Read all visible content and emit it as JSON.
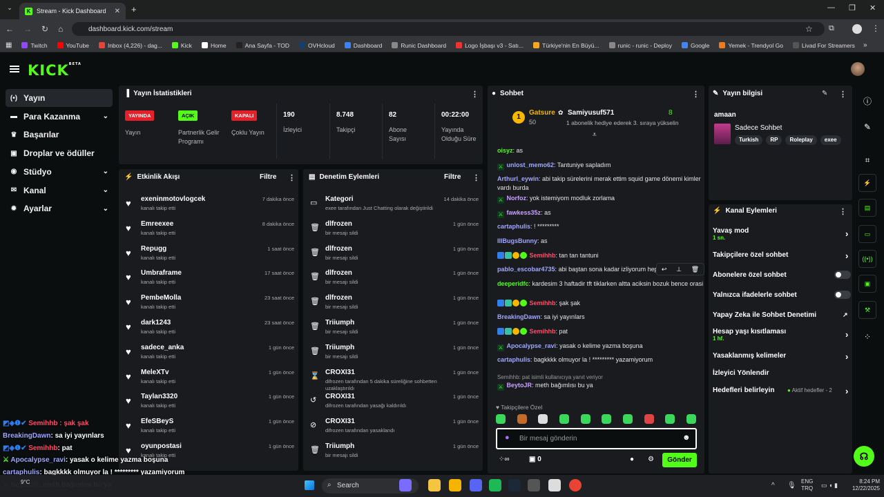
{
  "browser": {
    "tab_title": "Stream - Kick Dashboard",
    "url": "dashboard.kick.com/stream",
    "bookmarks": [
      {
        "label": "Twitch",
        "color": "#9146ff"
      },
      {
        "label": "YouTube",
        "color": "#ff0000"
      },
      {
        "label": "Inbox (4,226) - dag...",
        "color": "#ea4335"
      },
      {
        "label": "Kick",
        "color": "#53fc18"
      },
      {
        "label": "Home",
        "color": "#ffffff"
      },
      {
        "label": "Ana Sayfa - TOD",
        "color": "#222222"
      },
      {
        "label": "OVHcloud",
        "color": "#123f6d"
      },
      {
        "label": "Dashboard",
        "color": "#3b82f6"
      },
      {
        "label": "Runic Dashboard",
        "color": "#888888"
      },
      {
        "label": "Logo İşbaşı v3 - Satı...",
        "color": "#e33"
      },
      {
        "label": "Türkiye'nin En Büyü...",
        "color": "#f5a623"
      },
      {
        "label": "runic - runic - Deploy",
        "color": "#888888"
      },
      {
        "label": "Google",
        "color": "#4285f4"
      },
      {
        "label": "Yemek - Trendyol Go",
        "color": "#f27a1a"
      },
      {
        "label": "Livad For Streamers",
        "color": "#555555"
      }
    ]
  },
  "brand": {
    "logo": "KICK",
    "beta": "BETA"
  },
  "sidebar": [
    {
      "label": "Yayın",
      "icon": "broadcast-icon",
      "chev": ""
    },
    {
      "label": "Para Kazanma",
      "icon": "money-icon",
      "chev": "⌄"
    },
    {
      "label": "Başarılar",
      "icon": "trophy-icon",
      "chev": ""
    },
    {
      "label": "Droplar ve ödüller",
      "icon": "gift-icon",
      "chev": ""
    },
    {
      "label": "Stüdyo",
      "icon": "studio-icon",
      "chev": "⌄"
    },
    {
      "label": "Kanal",
      "icon": "channel-icon",
      "chev": "⌄"
    },
    {
      "label": "Ayarlar",
      "icon": "gear-icon",
      "chev": "⌄"
    }
  ],
  "stats": {
    "title": "Yayın İstatistikleri",
    "cols": [
      {
        "badge": "YAYINDA",
        "badge_color": "#e5202a",
        "label": "Yayın"
      },
      {
        "badge": "AÇIK",
        "badge_color": "#53fc18",
        "label": "Partnerlik Gelir Programı"
      },
      {
        "badge": "KAPALI",
        "badge_color": "#e5202a",
        "label": "Çoklu Yayın"
      }
    ],
    "values": [
      {
        "value": "190",
        "label": "İzleyici"
      },
      {
        "value": "8.748",
        "label": "Takipçi"
      },
      {
        "value": "82",
        "label": "Abone Sayısı"
      },
      {
        "value": "00:22:00",
        "label": "Yayında Olduğu Süre"
      }
    ]
  },
  "activity": {
    "title": "Etkinlik Akışı",
    "filter": "Filtre",
    "items": [
      {
        "name": "exeninmotovlogcek",
        "sub": "kanalı takip etti",
        "time": "7 dakika önce"
      },
      {
        "name": "Emreexee",
        "sub": "kanalı takip etti",
        "time": "8 dakika önce"
      },
      {
        "name": "Repugg",
        "sub": "kanalı takip etti",
        "time": "1 saat önce"
      },
      {
        "name": "Umbraframe",
        "sub": "kanalı takip etti",
        "time": "17 saat önce"
      },
      {
        "name": "PembeMolla",
        "sub": "kanalı takip etti",
        "time": "23 saat önce"
      },
      {
        "name": "dark1243",
        "sub": "kanalı takip etti",
        "time": "23 saat önce"
      },
      {
        "name": "sadece_anka",
        "sub": "kanalı takip etti",
        "time": "1 gün önce"
      },
      {
        "name": "MeleXTv",
        "sub": "kanalı takip etti",
        "time": "1 gün önce"
      },
      {
        "name": "Taylan3320",
        "sub": "kanalı takip etti",
        "time": "1 gün önce"
      },
      {
        "name": "EfeSBeyS",
        "sub": "kanalı takip etti",
        "time": "1 gün önce"
      },
      {
        "name": "oyunpostasi",
        "sub": "kanalı takip etti",
        "time": "1 gün önce"
      }
    ]
  },
  "moderation": {
    "title": "Denetim Eylemleri",
    "filter": "Filtre",
    "items": [
      {
        "icon": "category-icon",
        "name": "Kategori",
        "sub": "exee tarafından Just Chatting olarak değiştirildi",
        "time": "14 dakika önce"
      },
      {
        "icon": "trash-icon",
        "name": "dlfrozen",
        "sub": "bir mesajı sildi",
        "time": "1 gün önce"
      },
      {
        "icon": "trash-icon",
        "name": "dlfrozen",
        "sub": "bir mesajı sildi",
        "time": "1 gün önce"
      },
      {
        "icon": "trash-icon",
        "name": "dlfrozen",
        "sub": "bir mesajı sildi",
        "time": "1 gün önce"
      },
      {
        "icon": "trash-icon",
        "name": "dlfrozen",
        "sub": "bir mesajı sildi",
        "time": "1 gün önce"
      },
      {
        "icon": "trash-icon",
        "name": "Triiumph",
        "sub": "bir mesajı sildi",
        "time": "1 gün önce"
      },
      {
        "icon": "trash-icon",
        "name": "Triiumph",
        "sub": "bir mesajı sildi",
        "time": "1 gün önce"
      },
      {
        "icon": "hourglass-icon",
        "name": "CROXI31",
        "sub": "difrozen tarafından 5 dakika süreliğine sohbetten uzaklaştırıldı",
        "time": "1 gün önce"
      },
      {
        "icon": "undo-icon",
        "name": "CROXI31",
        "sub": "difrozen tarafından yasağı kaldırıldı",
        "time": "1 gün önce"
      },
      {
        "icon": "ban-icon",
        "name": "CROXI31",
        "sub": "difrozen tarafından yasaklandı",
        "time": "1 gün önce"
      },
      {
        "icon": "trash-icon",
        "name": "Triiumph",
        "sub": "bir mesajı sildi",
        "time": "1 gün önce"
      }
    ]
  },
  "chat": {
    "title": "Sohbet",
    "pinned": {
      "leader": "Gatsure",
      "leader_count": "50",
      "user": "Samiyusuf571",
      "count": "8",
      "sub": "1 abonelik hediye ederek 3. sıraya yükselin"
    },
    "messages": [
      {
        "user": "oisyz",
        "color": "#53fc18",
        "text": "as",
        "badges": ""
      },
      {
        "user": "unlost_memo62",
        "color": "#a0a7ff",
        "text": "Tantuniye sapladım",
        "badges": "m"
      },
      {
        "user": "Arthurl_eywin",
        "color": "#a0a7ff",
        "text": "abi takip sürelerini merak ettim squid game dönemi kimler vardı burda",
        "badges": ""
      },
      {
        "user": "Norfoz",
        "color": "#c9a2ff",
        "text": "yok istemiyom modluk zorlama",
        "badges": "m"
      },
      {
        "user": "fawkess35z",
        "color": "#c9a2ff",
        "text": "as",
        "badges": "m"
      },
      {
        "user": "cartaphulis",
        "color": "#a0a7ff",
        "text": "! *********",
        "badges": ""
      },
      {
        "user": "IllBugsBunny",
        "color": "#a0a7ff",
        "text": "as",
        "badges": ""
      },
      {
        "user": "Semihhb",
        "color": "#ff4d6a",
        "text": "tan tan tantuni",
        "badges": "full"
      },
      {
        "user": "pablo_escobar4735",
        "color": "#a0a7ff",
        "text": "abi baştan sona kadar izliyorum hepsini",
        "badges": ""
      },
      {
        "user": "deeperidfc",
        "color": "#53fc18",
        "text": "kardesim 3 haftadir tft tiklarken altta aciksin bozuk bence orasi",
        "badges": ""
      },
      {
        "user": "Semihhb",
        "color": "#ff4d6a",
        "text": "şak şak",
        "badges": "full"
      },
      {
        "user": "BreakingDawn",
        "color": "#a0a7ff",
        "text": "sa iyi yayınlars",
        "badges": ""
      },
      {
        "user": "Semihhb",
        "color": "#ff4d6a",
        "text": "pat",
        "badges": "full"
      },
      {
        "user": "Apocalypse_ravi",
        "color": "#a0a7ff",
        "text": "yasak o kelime yazma boşuna",
        "badges": "m"
      },
      {
        "user": "cartaphulis",
        "color": "#a0a7ff",
        "text": "bagkkkk olmuyor la ! ********* yazamiyorum",
        "badges": ""
      }
    ],
    "reply_hint": "Semihhb: pat isimli kullanıcıya yanıt veriyor",
    "reply_msg": {
      "user": "BeytoJR",
      "color": "#c9a2ff",
      "text": "meth bağımlısı bu ya"
    },
    "followers_only": "Takipçilere Özel",
    "input_placeholder": "Bir mesaj gönderin",
    "points": "0",
    "send": "Gönder"
  },
  "stream_info": {
    "title": "Yayın bilgisi",
    "stream_title": "amaan",
    "category": "Sadece Sohbet",
    "tags": [
      "Turkish",
      "RP",
      "Roleplay",
      "exee"
    ]
  },
  "channel_actions": {
    "title": "Kanal Eylemleri",
    "items": [
      {
        "label": "Yavaş mod",
        "sub": "1 sn.",
        "ctl": "chev"
      },
      {
        "label": "Takipçilere özel sohbet",
        "sub": "",
        "ctl": "chev"
      },
      {
        "label": "Abonelere özel sohbet",
        "sub": "",
        "ctl": "toggle"
      },
      {
        "label": "Yalnızca ifadelerle sohbet",
        "sub": "",
        "ctl": "toggle"
      },
      {
        "label": "Yapay Zeka ile Sohbet Denetimi",
        "sub": "",
        "ctl": "ext"
      },
      {
        "label": "Hesap yaşı kısıtlaması",
        "sub": "1 hf.",
        "ctl": "chev"
      },
      {
        "label": "Yasaklanmış kelimeler",
        "sub": "",
        "ctl": "chev"
      },
      {
        "label": "İzleyici Yönlendir",
        "sub": "",
        "ctl": ""
      },
      {
        "label": "Hedefleri belirleyin",
        "sub": "",
        "ctl": "goal"
      }
    ],
    "goal_status": "Aktif hedefler - 2"
  },
  "overlay": [
    {
      "user": "",
      "color": "#ff4d6a",
      "text": "Semihhb : şak şak"
    },
    {
      "user": "BreakingDawn",
      "color": "#a0a7ff",
      "text": ": sa iyi yayınlars"
    },
    {
      "user": "Semihhb",
      "color": "#ff4d6a",
      "text": ": pat"
    },
    {
      "user": "Apocalypse_ravi",
      "color": "#a0a7ff",
      "text": ": yasak o kelime yazma boşuna"
    },
    {
      "user": "cartaphulis",
      "color": "#a0a7ff",
      "text": ": bagkkkk olmuyor la ! ********* yazamiyorum"
    },
    {
      "user": "BeytoJR",
      "color": "#c9a2ff",
      "text": ": meth bağımlısı bu ya"
    }
  ],
  "taskbar": {
    "search": "Search",
    "weather": "9°C",
    "lang": "ENG",
    "lang2": "TRQ",
    "time": "8:24 PM",
    "date": "12/22/2025"
  }
}
